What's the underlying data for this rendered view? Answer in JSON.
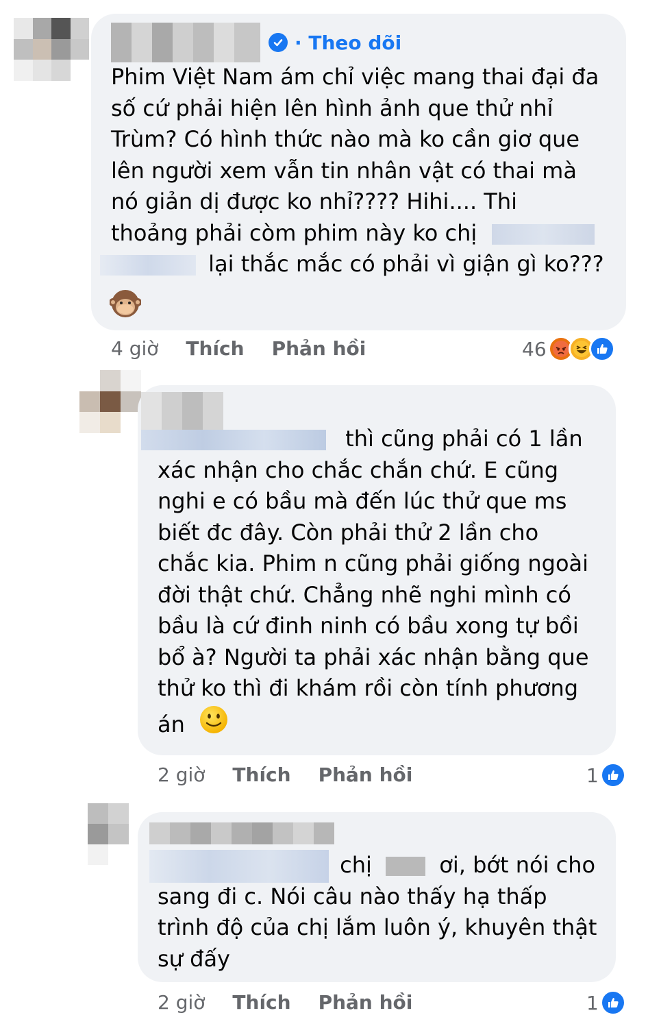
{
  "comments": [
    {
      "follow_label": "· Theo dõi",
      "lines": [
        "Phim Việt Nam ám chỉ việc mang thai đại đa",
        "số cứ phải hiện lên hình ảnh que thử nhỉ",
        "Trùm? Có hình thức nào mà ko cần giơ que",
        "lên người xem vẫn tin nhân vật có thai mà",
        "nó giản dị được ko nhỉ???? Hihi.... Thi",
        "thoảng phải còm phim này ko chị",
        "lại thắc mắc có phải vì giận gì ko???"
      ],
      "emoji_icon": "see-no-evil-monkey-icon",
      "time": "4 giờ",
      "like_label": "Thích",
      "reply_label": "Phản hồi",
      "reaction_count": "46",
      "reaction_icons": [
        "angry-icon",
        "haha-icon",
        "like-icon"
      ]
    },
    {
      "lines": [
        "thì cũng phải có 1 lần",
        "xác nhận cho chắc chắn chứ. E cũng",
        "nghi e có bầu mà đến lúc thử que ms",
        "biết đc đây. Còn phải thử 2 lần cho",
        "chắc kia. Phim n cũng phải giống ngoài",
        "đời thật chứ. Chẳng nhẽ nghi mình có",
        "bầu là cứ đinh ninh có bầu xong tự bồi",
        "bổ à? Người ta phải xác nhận bằng que",
        "thử ko thì đi khám rồi còn tính phương",
        "án"
      ],
      "emoji_icon": "slightly-smiling-face-icon",
      "time": "2 giờ",
      "like_label": "Thích",
      "reply_label": "Phản hồi",
      "reaction_count": "1",
      "reaction_icons": [
        "like-icon"
      ]
    },
    {
      "lines": [
        "chị",
        "ơi, bớt nói cho",
        "sang đi c. Nói câu nào thấy hạ thấp",
        "trình độ của chị lắm luôn ý, khuyên thật",
        "sự đấy"
      ],
      "time": "2 giờ",
      "like_label": "Thích",
      "reply_label": "Phản hồi",
      "reaction_count": "1",
      "reaction_icons": [
        "like-icon"
      ]
    }
  ],
  "colors": {
    "bubble": "#f0f2f5",
    "text": "#050505",
    "meta": "#65676b",
    "accent": "#1877f2"
  }
}
